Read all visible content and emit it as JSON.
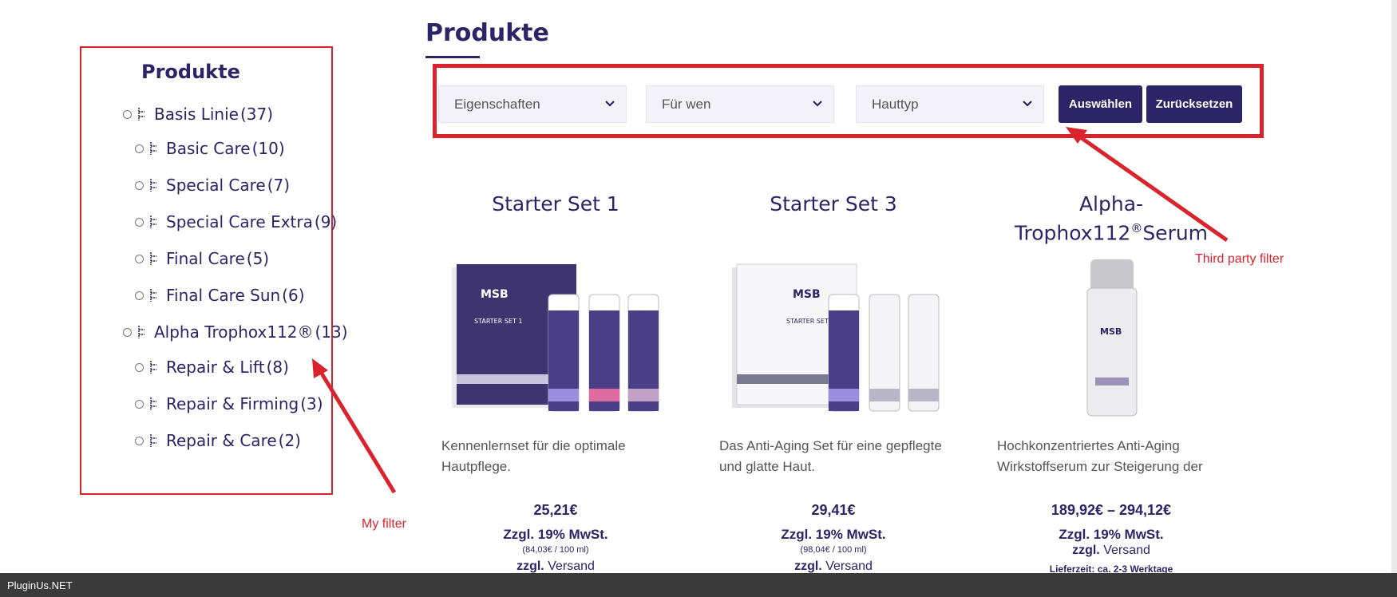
{
  "sidebar": {
    "title": "Produkte",
    "categories": [
      {
        "name": "Basis Linie",
        "count": "(37)"
      },
      {
        "name": "Basic Care",
        "count": "(10)"
      },
      {
        "name": "Special Care",
        "count": "(7)"
      },
      {
        "name": "Special Care Extra",
        "count": "(9)"
      },
      {
        "name": "Final Care",
        "count": "(5)"
      },
      {
        "name": "Final Care Sun",
        "count": "(6)"
      },
      {
        "name": "Alpha Trophox112®",
        "count": "(13)"
      },
      {
        "name": "Repair & Lift",
        "count": "(8)"
      },
      {
        "name": "Repair & Firming",
        "count": "(3)"
      },
      {
        "name": "Repair & Care",
        "count": "(2)"
      }
    ]
  },
  "main": {
    "title": "Produkte",
    "filters": {
      "select1": "Eigenschaften",
      "select2": "Für wen",
      "select3": "Hauttyp",
      "apply_label": "Auswählen",
      "reset_label": "Zurücksetzen"
    },
    "products": [
      {
        "title": "Starter Set 1",
        "box_text": "STARTER SET 1",
        "desc_line1": "Kennenlernset für die optimale",
        "desc_line2": "Hautpflege.",
        "price": "25,21€",
        "tax": "Zzgl. 19% MwSt.",
        "unit_price": "(84,03€ / 100 ml)",
        "ship_bold": "zzgl.",
        "ship": "Versand"
      },
      {
        "title": "Starter Set 3",
        "box_text": "STARTER SET 3",
        "desc_line1": "Das Anti-Aging Set für eine gepflegte",
        "desc_line2": "und glatte Haut.",
        "price": "29,41€",
        "tax": "Zzgl. 19% MwSt.",
        "unit_price": "(98,04€ / 100 ml)",
        "ship_bold": "zzgl.",
        "ship": "Versand"
      },
      {
        "title_line1": "Alpha-",
        "title_line2": "Trophox112",
        "title_sup": "®",
        "title_line2b": "Serum",
        "desc_line1": "Hochkonzentriertes Anti-Aging",
        "desc_line2": "Wirkstoffserum zur Steigerung der",
        "price": "189,92€ – 294,12€",
        "tax": "Zzgl. 19% MwSt.",
        "ship_bold": "zzgl.",
        "ship": "Versand",
        "delivery": "Lieferzeit: ca. 2-3 Werktage"
      }
    ]
  },
  "annotations": {
    "third_party": "Third  party filter",
    "my_filter": "My  filter"
  },
  "footer": {
    "text": "PluginUs.NET"
  },
  "colors": {
    "brand": "#2b2466",
    "annotation": "#d9232d",
    "footer": "#3a3a3a"
  }
}
